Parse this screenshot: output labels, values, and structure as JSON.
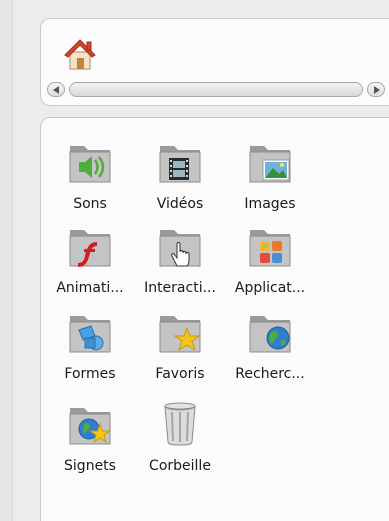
{
  "items": [
    {
      "label": "Sons",
      "icon": "folder-sound-icon"
    },
    {
      "label": "Vidéos",
      "icon": "folder-video-icon"
    },
    {
      "label": "Images",
      "icon": "folder-images-icon"
    },
    {
      "label": "Animati...",
      "icon": "folder-flash-icon"
    },
    {
      "label": "Interacti...",
      "icon": "folder-hand-icon"
    },
    {
      "label": "Applicat...",
      "icon": "folder-apps-icon"
    },
    {
      "label": "Formes",
      "icon": "folder-shapes-icon"
    },
    {
      "label": "Favoris",
      "icon": "folder-star-icon"
    },
    {
      "label": "Recherc...",
      "icon": "folder-globe-icon"
    },
    {
      "label": "Signets",
      "icon": "folder-globe-star-icon"
    },
    {
      "label": "Corbeille",
      "icon": "trash-icon"
    }
  ],
  "colors": {
    "folder": "#8f8f8f",
    "home_roof": "#d2452a",
    "accent_green": "#4fae3b"
  }
}
